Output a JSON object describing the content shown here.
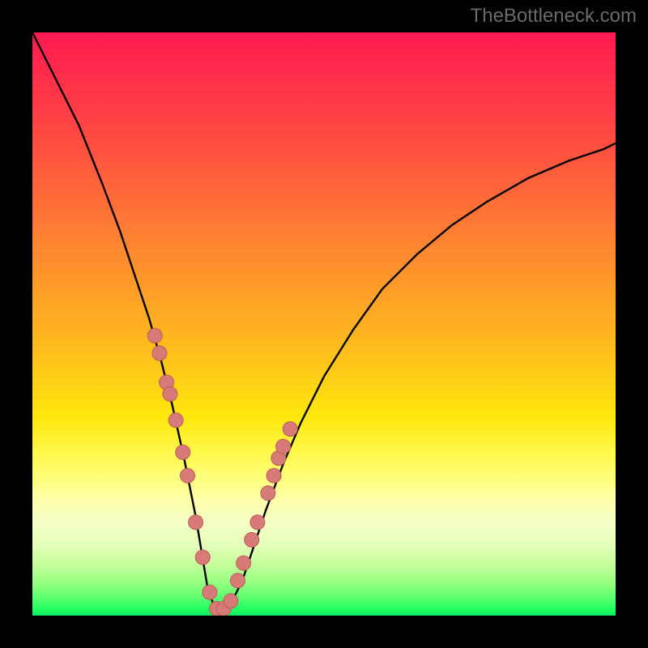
{
  "watermark": {
    "text": "TheBottleneck.com"
  },
  "colors": {
    "page_bg": "#000000",
    "curve_stroke": "#000000",
    "marker_fill": "#d77a78",
    "marker_stroke": "#b85c58",
    "watermark": "#6a6a6a",
    "gradient_top": "#ff1a50",
    "gradient_bottom": "#14e862"
  },
  "chart_data": {
    "type": "line",
    "title": "",
    "xlabel": "",
    "ylabel": "",
    "ylim": [
      0,
      100
    ],
    "xlim": [
      0,
      100
    ],
    "series": [
      {
        "name": "bottleneck-curve",
        "x": [
          0,
          4,
          8,
          12,
          15,
          18,
          20,
          22,
          24,
          26,
          27,
          28,
          29,
          30,
          31,
          32,
          33,
          34,
          36,
          38,
          40,
          43,
          46,
          50,
          55,
          60,
          66,
          72,
          78,
          85,
          92,
          98,
          100
        ],
        "y": [
          100,
          92,
          84,
          74,
          66,
          57,
          51,
          44,
          36,
          27,
          22,
          17,
          11,
          5,
          2,
          1,
          1,
          2,
          6,
          12,
          18,
          26,
          33,
          41,
          49,
          56,
          62,
          67,
          71,
          75,
          78,
          80,
          81
        ]
      }
    ],
    "markers": {
      "name": "highlighted-points",
      "x": [
        21.0,
        21.8,
        23.0,
        23.6,
        24.6,
        25.8,
        26.6,
        28.0,
        29.2,
        30.4,
        31.6,
        32.8,
        34.0,
        35.2,
        36.2,
        37.6,
        38.6,
        40.4,
        41.4,
        42.2,
        43.0,
        44.2
      ],
      "y": [
        48.0,
        45.0,
        40.0,
        38.0,
        33.5,
        28.0,
        24.0,
        16.0,
        10.0,
        4.0,
        1.2,
        1.2,
        2.5,
        6.0,
        9.0,
        13.0,
        16.0,
        21.0,
        24.0,
        27.0,
        29.0,
        32.0
      ]
    }
  }
}
